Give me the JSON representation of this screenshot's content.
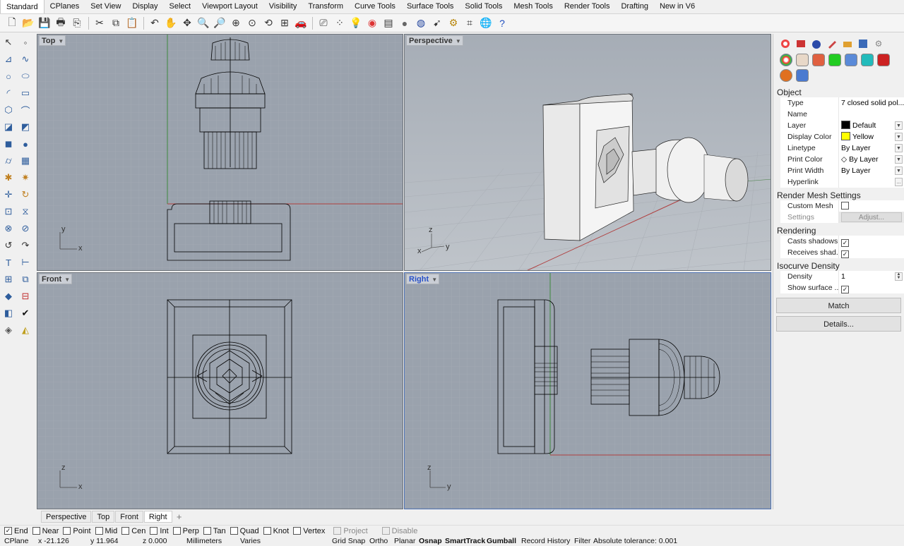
{
  "tabs": [
    "Standard",
    "CPlanes",
    "Set View",
    "Display",
    "Select",
    "Viewport Layout",
    "Visibility",
    "Transform",
    "Curve Tools",
    "Surface Tools",
    "Solid Tools",
    "Mesh Tools",
    "Render Tools",
    "Drafting",
    "New in V6"
  ],
  "active_tab": "Standard",
  "toolbar_icons": [
    "new-file-icon",
    "open-folder-icon",
    "save-icon",
    "print-icon",
    "import-icon",
    "cut-icon",
    "copy-icon",
    "paste-icon",
    "undo-icon",
    "pan-hand-icon",
    "move-view-icon",
    "zoom-dynamic-icon",
    "zoom-window-icon",
    "zoom-extents-icon",
    "zoom-selected-icon",
    "rotate-view-icon",
    "four-viewports-icon",
    "car-icon",
    "named-views-icon",
    "points-icon",
    "lightbulb-icon",
    "color-wheel-icon",
    "layer-palette-icon",
    "shaded-sphere-icon",
    "render-sphere-icon",
    "select-pointer-icon",
    "options-gear-icon",
    "scripts-icon",
    "globe-icon",
    "help-icon"
  ],
  "viewports": {
    "top": {
      "label": "Top",
      "axis_v": "y",
      "axis_h": "x"
    },
    "perspective": {
      "label": "Perspective",
      "axis_v": "z",
      "axis_a": "x",
      "axis_b": "y"
    },
    "front": {
      "label": "Front",
      "axis_v": "z",
      "axis_h": "x"
    },
    "right": {
      "label": "Right",
      "axis_v": "z",
      "axis_h": "y"
    }
  },
  "active_viewport": "Right",
  "viewport_tabs": [
    "Perspective",
    "Top",
    "Front",
    "Right"
  ],
  "active_viewport_tab": "Right",
  "panel": {
    "object_title": "Object",
    "properties": [
      {
        "label": "Type",
        "value": "7 closed solid pol..."
      },
      {
        "label": "Name",
        "value": ""
      },
      {
        "label": "Layer",
        "value": "Default",
        "color": "#000000",
        "dropdown": true
      },
      {
        "label": "Display Color",
        "value": "Yellow",
        "color": "#ffff00",
        "dropdown": true
      },
      {
        "label": "Linetype",
        "value": "By Layer",
        "dropdown": true
      },
      {
        "label": "Print Color",
        "value": "By Layer",
        "dropdown": true,
        "diamond": true
      },
      {
        "label": "Print Width",
        "value": "By Layer",
        "dropdown": true
      },
      {
        "label": "Hyperlink",
        "value": "",
        "ellipsis": "..."
      }
    ],
    "render_mesh_title": "Render Mesh Settings",
    "custom_mesh_label": "Custom Mesh",
    "custom_mesh_checked": false,
    "settings_label": "Settings",
    "adjust_label": "Adjust...",
    "rendering_title": "Rendering",
    "casts_shadows_label": "Casts shadows",
    "casts_shadows_checked": true,
    "receives_shadows_label": "Receives shad...",
    "receives_shadows_checked": true,
    "isocurve_title": "Isocurve Density",
    "density_label": "Density",
    "density_value": "1",
    "show_surface_label": "Show surface ...",
    "show_surface_checked": true,
    "match_label": "Match",
    "details_label": "Details..."
  },
  "osnaps": [
    {
      "label": "End",
      "checked": true,
      "enabled": true
    },
    {
      "label": "Near",
      "checked": false,
      "enabled": true
    },
    {
      "label": "Point",
      "checked": false,
      "enabled": true
    },
    {
      "label": "Mid",
      "checked": false,
      "enabled": true
    },
    {
      "label": "Cen",
      "checked": false,
      "enabled": true
    },
    {
      "label": "Int",
      "checked": false,
      "enabled": true
    },
    {
      "label": "Perp",
      "checked": false,
      "enabled": true
    },
    {
      "label": "Tan",
      "checked": false,
      "enabled": true
    },
    {
      "label": "Quad",
      "checked": false,
      "enabled": true
    },
    {
      "label": "Knot",
      "checked": false,
      "enabled": true
    },
    {
      "label": "Vertex",
      "checked": false,
      "enabled": true
    },
    {
      "label": "Project",
      "checked": false,
      "enabled": false
    },
    {
      "label": "Disable",
      "checked": false,
      "enabled": false
    }
  ],
  "status": {
    "cplane": "CPlane",
    "x": "x -21.126",
    "y": "y 11.964",
    "z": "z 0.000",
    "units": "Millimeters",
    "layer": "Varies",
    "grid_snap": "Grid Snap",
    "ortho": "Ortho",
    "planar": "Planar",
    "osnap": "Osnap",
    "smarttrack": "SmartTrack",
    "gumball": "Gumball",
    "record_history": "Record History",
    "filter": "Filter",
    "tolerance": "Absolute tolerance: 0.001"
  }
}
